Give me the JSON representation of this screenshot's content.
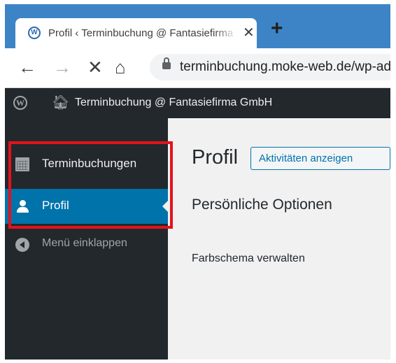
{
  "browser": {
    "tab": {
      "title": "Profil ‹ Terminbuchung @ Fantasiefirma GmbH",
      "close_glyph": "✕",
      "favicon": "wp-favicon-icon"
    },
    "new_tab_glyph": "+",
    "nav": {
      "back": "←",
      "forward": "→",
      "stop": "✕",
      "home": "⌂"
    },
    "address": {
      "url": "terminbuchung.moke-web.de/wp-admin/profile.php",
      "secure": true
    }
  },
  "admin_bar": {
    "logo": "W",
    "home_icon": "home-icon",
    "site_title": "Terminbuchung @ Fantasiefirma GmbH"
  },
  "sidebar": {
    "items": [
      {
        "label": "Terminbuchungen",
        "icon": "calendar-icon",
        "current": false
      },
      {
        "label": "Profil",
        "icon": "user-icon",
        "current": true
      },
      {
        "label": "Menü einklappen",
        "icon": "collapse-icon",
        "current": false
      }
    ]
  },
  "main": {
    "title": "Profil",
    "title_action": "Aktivitäten anzeigen",
    "section_title": "Persönliche Optionen",
    "field_label": "Farbschema verwalten"
  },
  "colors": {
    "browser_tab_strip": "#3d84c6",
    "admin_dark": "#23282d",
    "menu_current": "#0073aa",
    "highlight_box": "#e3131b",
    "content_bg": "#f1f1f1"
  }
}
